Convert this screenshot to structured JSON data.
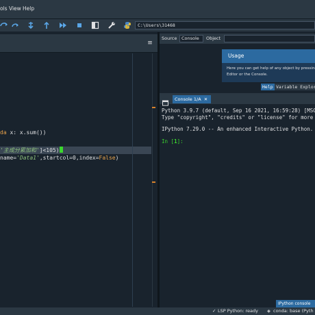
{
  "menu": {
    "tools": "ols",
    "view": "View",
    "help": "Help"
  },
  "toolbar": {
    "path": "C:\\Users\\31468",
    "icons": [
      "step-over-icon",
      "step-into-icon",
      "step-return-icon",
      "continue-icon",
      "stop-icon",
      "maximize-icon",
      "wrench-icon",
      "python-icon"
    ]
  },
  "editor": {
    "menu_glyph": "≡",
    "lines": {
      "lambda_kw": "da",
      "lambda_rest": " x: x.sum())",
      "mask_str": "'主成分累加和'",
      "mask_rest": "]<105)",
      "excel_prefix": "name=",
      "excel_str": "'Data1'",
      "excel_mid": ",startcol=",
      "excel_num": "0",
      "excel_mid2": ",index=",
      "excel_kw": "False",
      "excel_end": ")"
    }
  },
  "help": {
    "source_label": "Source",
    "source_value": "Console",
    "object_label": "Object",
    "usage_title": "Usage",
    "usage_text_1": "Here you can get help of any object by pressing",
    "usage_text_2": "Editor or the Console.",
    "tab_help": "Help",
    "tab_variable": "Variable Explore"
  },
  "console": {
    "tab_label": "Console 1/A",
    "line1": "Python 3.9.7 (default, Sep 16 2021, 16:59:28) [MSC",
    "line2": "Type \"copyright\", \"credits\" or \"license\" for more",
    "line3": "IPython 7.29.0 -- An enhanced Interactive Python.",
    "prompt_in": "In [",
    "prompt_num": "1",
    "prompt_end": "]:",
    "bottom_tab": "IPython console"
  },
  "status": {
    "lsp": "LSP Python: ready",
    "conda": "conda: base (Pyth"
  },
  "colors": {
    "accent": "#2c6aa0",
    "background": "#19232d",
    "panel": "#2b3843"
  }
}
